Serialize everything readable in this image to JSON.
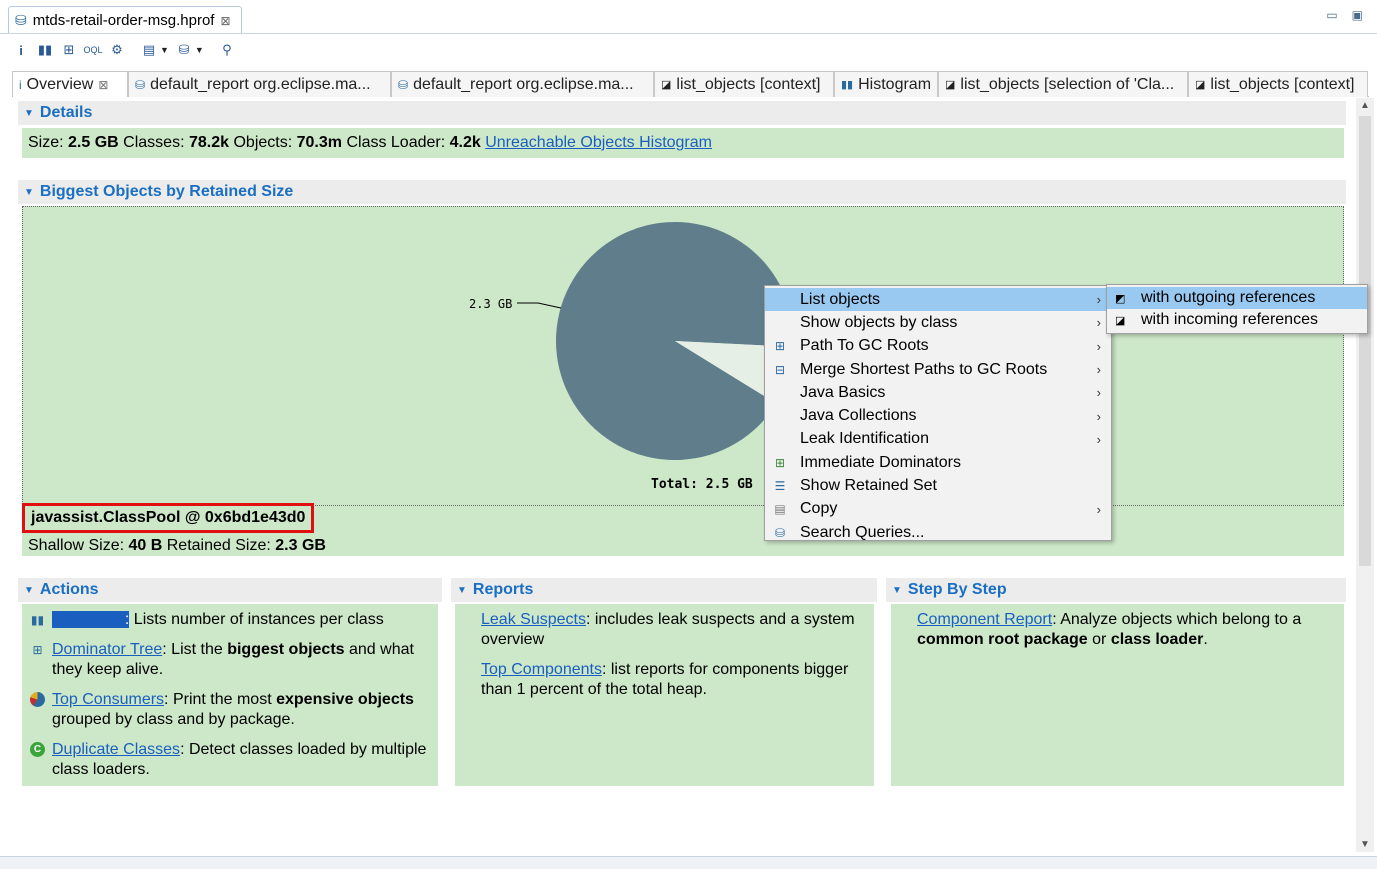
{
  "editor": {
    "file_tab": "mtds-retail-order-msg.hprof",
    "close": "⊠"
  },
  "window_buttons": {
    "minimize": "▭",
    "maximize": "▣"
  },
  "toolbar": {
    "icons": [
      "info-icon",
      "histogram-icon",
      "dominator-tree-icon",
      "oql-icon",
      "heap-settings-icon",
      "query-browser-icon",
      "report-icon",
      "search-icon"
    ]
  },
  "subtabs": [
    {
      "label": "Overview",
      "icon": "overview-icon",
      "closable": true
    },
    {
      "label": "default_report  org.eclipse.ma...",
      "icon": "report-icon"
    },
    {
      "label": "default_report  org.eclipse.ma...",
      "icon": "report-icon"
    },
    {
      "label": "list_objects [context]",
      "icon": "list-icon"
    },
    {
      "label": "Histogram",
      "icon": "histogram-icon"
    },
    {
      "label": "list_objects [selection of 'Cla...",
      "icon": "list-icon"
    },
    {
      "label": "list_objects [context]",
      "icon": "list-icon"
    }
  ],
  "details": {
    "title": "Details",
    "size_label": "Size:",
    "size": "2.5 GB",
    "classes_label": "Classes:",
    "classes": "78.2k",
    "objects_label": "Objects:",
    "objects": "70.3m",
    "loader_label": "Class Loader:",
    "loader": "4.2k",
    "link": "Unreachable Objects Histogram"
  },
  "biggest": {
    "title": "Biggest Objects by Retained Size",
    "selected_object": "javassist.ClassPool @ 0x6bd1e43d0",
    "shallow_label": "Shallow Size:",
    "shallow": "40 B",
    "retained_label": "Retained Size:",
    "retained": "2.3 GB"
  },
  "chart_data": {
    "type": "pie",
    "slices": [
      {
        "label": "2.3 GB",
        "value": 2.3,
        "color": "#607d8b"
      },
      {
        "label": "",
        "value": 0.2,
        "color": "#e6efe6"
      }
    ],
    "slice_label": "2.3 GB",
    "total_label": "Total:  2.5 GB"
  },
  "actions": {
    "title": "Actions",
    "items": [
      {
        "link": "Histogram",
        "sep": ":",
        "text": " Lists number of instances per class"
      },
      {
        "link": "Dominator Tree",
        "sep": ":",
        "text": " List the ",
        "bold": "biggest objects",
        "text2": " and what they keep alive."
      },
      {
        "link": "Top Consumers",
        "sep": ":",
        "text": " Print the most ",
        "bold": "expensive objects",
        "text2": " grouped by class and by package."
      },
      {
        "link": "Duplicate Classes",
        "sep": ":",
        "text": " Detect classes loaded by multiple class loaders."
      }
    ]
  },
  "reports": {
    "title": "Reports",
    "items": [
      {
        "link": "Leak Suspects",
        "text": ": includes leak suspects and a system overview"
      },
      {
        "link": "Top Components",
        "text": ": list reports for components bigger than 1 percent of the total heap."
      }
    ]
  },
  "stepbystep": {
    "title": "Step By Step",
    "link": "Component Report",
    "text": ": Analyze objects which belong to a ",
    "bold1": "common root package",
    "or": " or ",
    "bold2": "class loader",
    "end": "."
  },
  "context_menu": {
    "items": [
      {
        "label": "List objects",
        "submenu": true,
        "selected": true,
        "icon": ""
      },
      {
        "label": "Show objects by class",
        "submenu": true,
        "icon": ""
      },
      {
        "label": "Path To GC Roots",
        "submenu": true,
        "icon": "path-gc-icon"
      },
      {
        "label": "Merge Shortest Paths to GC Roots",
        "submenu": true,
        "icon": "merge-paths-icon"
      },
      {
        "label": "Java Basics",
        "submenu": true,
        "icon": ""
      },
      {
        "label": "Java Collections",
        "submenu": true,
        "icon": ""
      },
      {
        "label": "Leak Identification",
        "submenu": true,
        "icon": ""
      },
      {
        "label": "Immediate Dominators",
        "submenu": false,
        "icon": "dominators-icon"
      },
      {
        "label": "Show Retained Set",
        "submenu": false,
        "icon": "retained-set-icon"
      },
      {
        "label": "Copy",
        "submenu": true,
        "icon": "copy-icon"
      },
      {
        "label": "Search Queries...",
        "submenu": false,
        "icon": "search-queries-icon"
      }
    ],
    "submenu": [
      {
        "label": "with outgoing references",
        "selected": true
      },
      {
        "label": "with incoming references",
        "selected": false
      }
    ]
  }
}
